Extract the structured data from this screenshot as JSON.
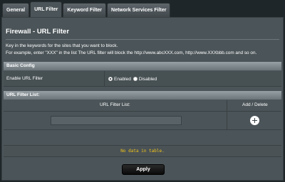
{
  "tabs": [
    {
      "label": "General",
      "active": false
    },
    {
      "label": "URL Filter",
      "active": true
    },
    {
      "label": "Keyword Filter",
      "active": false
    },
    {
      "label": "Network Services Filter",
      "active": false
    }
  ],
  "page": {
    "title": "Firewall - URL Filter",
    "description_line1": "Key in the keywords for the sites that you want to block.",
    "description_line2": "For example, enter \"XXX\" in the list The URL filter will block the http://www.abcXXX.com, http://www.XXXbbb.com and so on."
  },
  "basic_config": {
    "header": "Basic Config",
    "enable_label": "Enable URL Filter",
    "options": [
      {
        "label": "Enabled",
        "checked": true
      },
      {
        "label": "Disabled",
        "checked": false
      }
    ]
  },
  "filter_list": {
    "header": "URL Filter List:",
    "columns": [
      "URL Filter List:",
      "Add / Delete"
    ],
    "input_value": "",
    "empty_message": "No data in table."
  },
  "actions": {
    "apply_label": "Apply"
  },
  "colors": {
    "panel_bg": "#4b5458",
    "header_bar": "#8a9398",
    "empty_text": "#f0c419",
    "apply_bg": "#111111"
  }
}
